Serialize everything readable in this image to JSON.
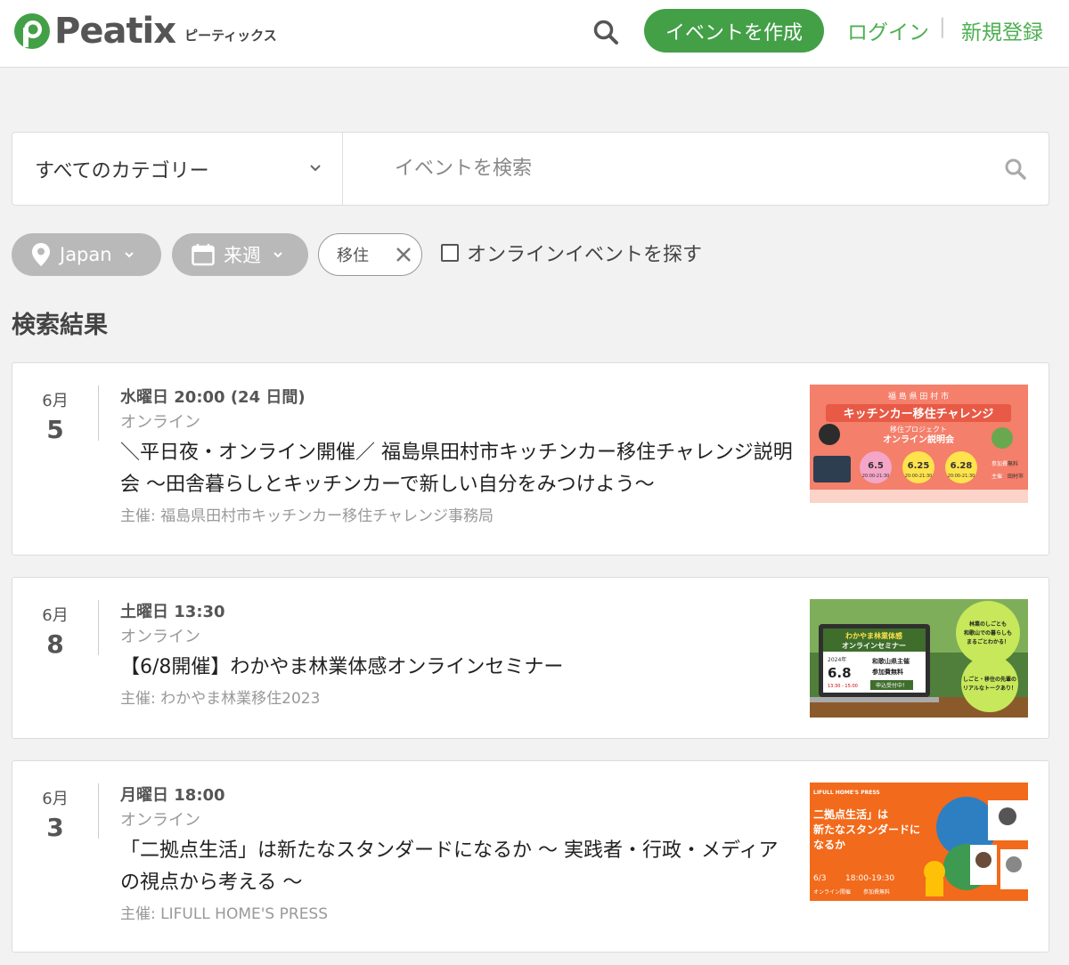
{
  "header": {
    "logo_text": "Peatix",
    "logo_kana": "ピーティックス",
    "create_event": "イベントを作成",
    "login": "ログイン",
    "separator": "|",
    "signup": "新規登録"
  },
  "search": {
    "category": "すべてのカテゴリー",
    "placeholder": "イベントを検索"
  },
  "filters": {
    "location": "Japan",
    "date": "来週",
    "tag": "移住",
    "online_label": "オンラインイベントを探す",
    "online_checked": false
  },
  "results_title": "検索結果",
  "events": [
    {
      "month": "6月",
      "day": "5",
      "when": "水曜日 20:00 (24 日間)",
      "venue": "オンライン",
      "title": "＼平日夜・オンライン開催／ 福島県田村市キッチンカー移住チャレンジ説明会 〜田舎暮らしとキッチンカーで新しい自分をみつけよう〜",
      "organizer": "主催: 福島県田村市キッチンカー移住チャレンジ事務局",
      "thumb": {
        "top": "福 島 県 田 村 市",
        "headline": "キッチンカー移住チャレンジ",
        "sub1": "移住プロジェクト",
        "sub2": "オンライン説明会",
        "dates": [
          "6.5",
          "6.25",
          "6.28"
        ],
        "time": "20:00-21:30",
        "badge1": "参加費",
        "badge1b": "無料",
        "badge2": "主催",
        "badge2b": "田村市"
      }
    },
    {
      "month": "6月",
      "day": "8",
      "when": "土曜日 13:30",
      "venue": "オンライン",
      "title": "【6/8開催】わかやま林業体感オンラインセミナー",
      "organizer": "主催: わかやま林業移住2023",
      "thumb": {
        "screen_title1": "わかやま林業体感",
        "screen_title2": "オンラインセミナー",
        "year": "2024年",
        "date": "6.8",
        "host": "和歌山県主催",
        "fee": "参加費無料",
        "time": "13:30 - 15:00",
        "cta": "申込受付中！",
        "bubble1": "林業のしごとも和歌山での暮らしもまるごとわかる！",
        "bubble2": "しごと・移住の先輩のリアルなトークあり！"
      }
    },
    {
      "month": "6月",
      "day": "3",
      "when": "月曜日 18:00",
      "venue": "オンライン",
      "title": "「二拠点生活」は新たなスタンダードになるか 〜 実践者・行政・メディアの視点から考える 〜",
      "organizer": "主催: LIFULL HOME'S PRESS",
      "thumb": {
        "brand": "LIFULL HOME'S PRESS",
        "headline1": "二拠点生活」は",
        "headline2": "新たなスタンダードに",
        "headline3": "なるか",
        "date": "6/3",
        "time": "18:00-19:30",
        "mode": "オンライン開催",
        "fee": "参加費無料"
      }
    }
  ],
  "colors": {
    "brand_green": "#43a047",
    "link_green": "#4caf50",
    "chip_gray": "#b9b9b9",
    "page_bg": "#f2f2f2"
  },
  "icons": [
    "search-icon",
    "chevron-down-icon",
    "location-pin-icon",
    "calendar-icon",
    "close-icon"
  ]
}
